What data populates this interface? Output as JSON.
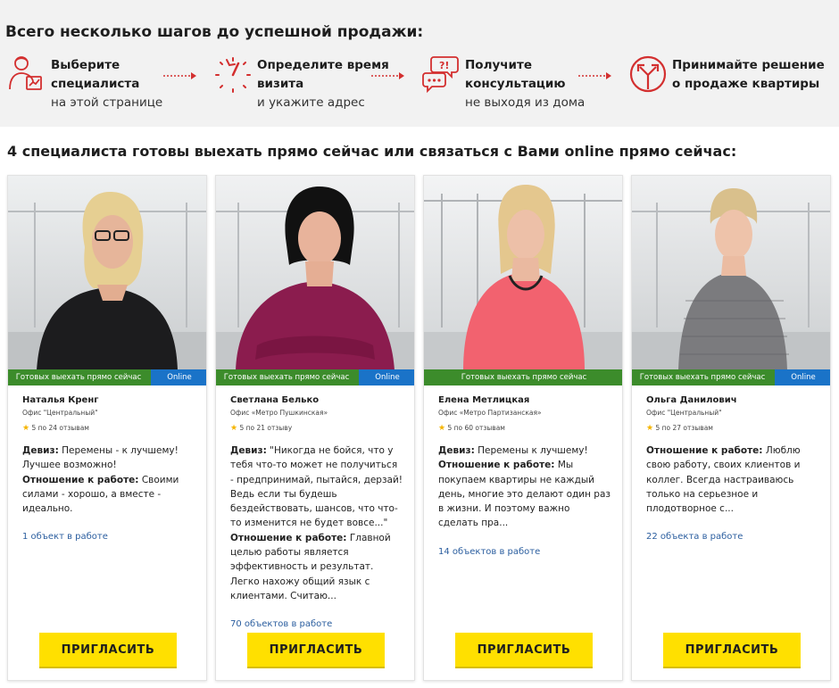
{
  "steps_section": {
    "title": "Всего несколько шагов до успешной продажи:",
    "steps": [
      {
        "icon": "specialist-icon",
        "bold1": "Выберите",
        "bold2": "специалиста",
        "normal": "на этой странице"
      },
      {
        "icon": "stopwatch-icon",
        "bold1": "Определите время",
        "bold2": "визита",
        "normal": "и укажите адрес"
      },
      {
        "icon": "consult-chat-icon",
        "bold1": "Получите",
        "bold2": "консультацию",
        "normal": "не выходя из дома"
      },
      {
        "icon": "crossroads-icon",
        "bold1": "Принимайте решение",
        "bold2": "о продаже квартиры",
        "normal": ""
      }
    ]
  },
  "specialists_title": "4 специалиста готовы выехать прямо сейчас или связаться с Вами online прямо сейчас:",
  "colors": {
    "accent_red": "#d32f2f",
    "ready_green": "#3c8c2b",
    "online_blue": "#1a73c8",
    "button_yellow": "#ffe000",
    "link_blue": "#2b5e9f"
  },
  "specialists": [
    {
      "ready_label": "Готовых выехать прямо сейчас",
      "online_label": "Online",
      "name": "Наталья Кренг",
      "office": "Офис \"Центральный\"",
      "rating": "5 по 24 отзывам",
      "motto_label": "Девиз:",
      "motto": "Перемены - к лучшему! Лучшее возможно!",
      "attitude_label": "Отношение к работе:",
      "attitude": "Своими силами - хорошо, а вместе - идеально.",
      "objects": "1 объект в работе",
      "button": "ПРИГЛАСИТЬ"
    },
    {
      "ready_label": "Готовых выехать прямо сейчас",
      "online_label": "Online",
      "name": "Светлана Белько",
      "office": "Офис «Метро Пушкинская»",
      "rating": "5 по 21 отзыву",
      "motto_label": "Девиз:",
      "motto": "\"Никогда не бойся, что у тебя что-то может не получиться - предпринимай, пытайся, дерзай! Ведь если ты будешь бездействовать, шансов, что что-то изменится не будет вовсе...\"",
      "attitude_label": "Отношение к работе:",
      "attitude": "Главной целью работы является эффективность и результат. Легко нахожу общий язык с клиентами. Считаю...",
      "objects": "70 объектов в работе",
      "button": "ПРИГЛАСИТЬ"
    },
    {
      "ready_label": "Готовых выехать прямо сейчас",
      "online_label": "",
      "name": "Елена Метлицкая",
      "office": "Офис «Метро Партизанская»",
      "rating": "5 по 60 отзывам",
      "motto_label": "Девиз:",
      "motto": "Перемены к лучшему!",
      "attitude_label": "Отношение к работе:",
      "attitude": "Мы покупаем квартиры не каждый день, многие это делают один раз в жизни. И поэтому важно сделать пра...",
      "objects": "14 объектов в работе",
      "button": "ПРИГЛАСИТЬ"
    },
    {
      "ready_label": "Готовых выехать прямо сейчас",
      "online_label": "Online",
      "name": "Ольга Данилович",
      "office": "Офис \"Центральный\"",
      "rating": "5 по 27 отзывам",
      "motto_label": "",
      "motto": "",
      "attitude_label": "Отношение к работе:",
      "attitude": "Люблю свою работу, своих клиентов и коллег. Всегда настраиваюсь только на серьезное и плодотворное с...",
      "objects": "22 объекта в работе",
      "button": "ПРИГЛАСИТЬ"
    }
  ]
}
